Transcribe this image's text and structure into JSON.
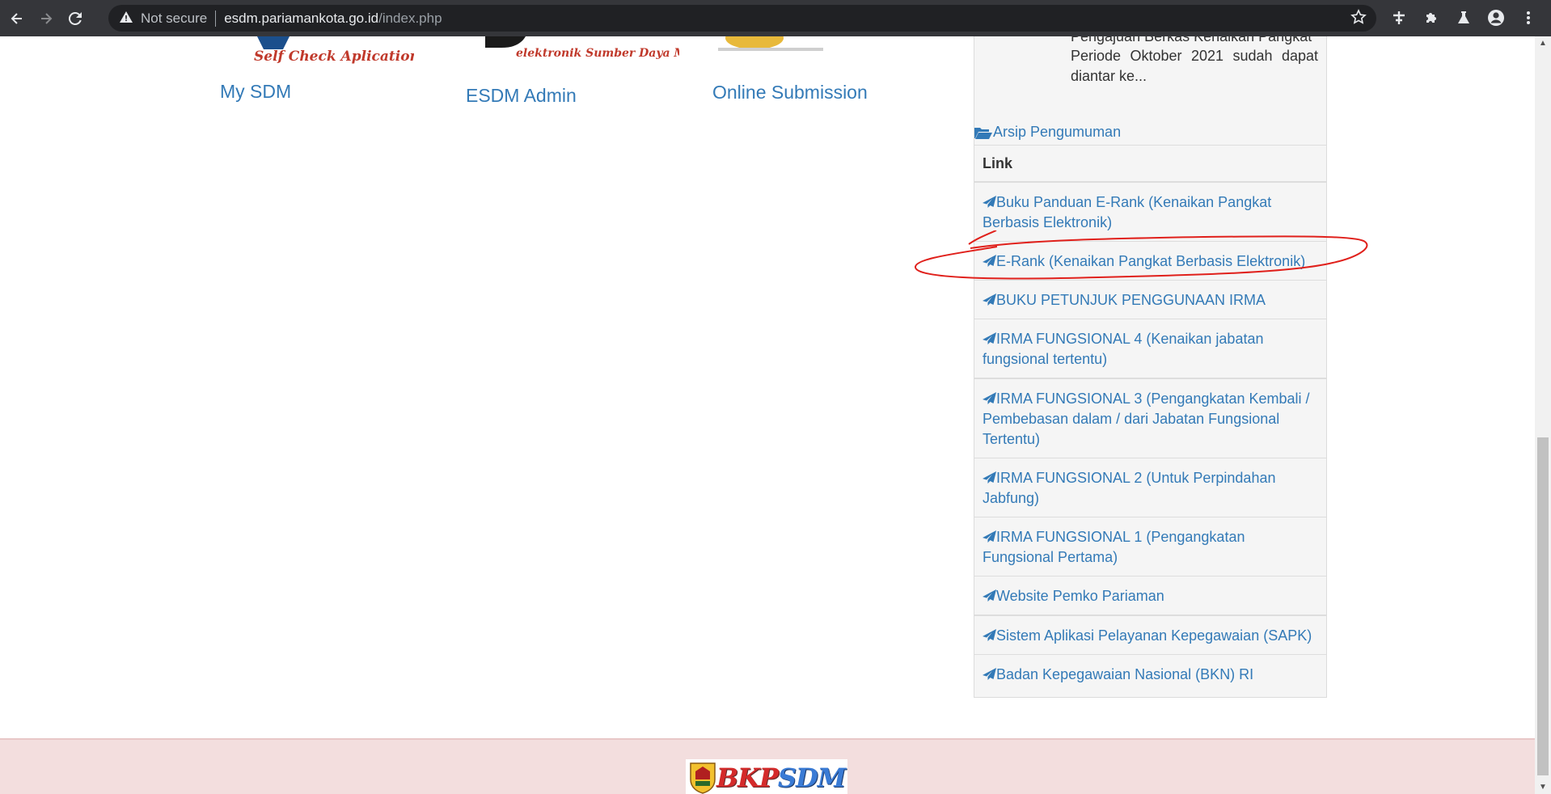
{
  "browser": {
    "security_label": "Not secure",
    "url_host": "esdm.pariamankota.go.id",
    "url_path": "/index.php"
  },
  "apps": [
    {
      "label": "My SDM",
      "logo_text": "Self Check Aplication"
    },
    {
      "label": "ESDM Admin",
      "logo_text": "elektronik Sumber Daya Manusia"
    },
    {
      "label": "Online Submission"
    }
  ],
  "announcement": {
    "cut_line": "Pengajuan Berkas Kenaikan Pangkat",
    "text": "Periode Oktober 2021 sudah dapat diantar ke...",
    "archive_label": "Arsip Pengumuman"
  },
  "links": {
    "heading": "Link",
    "items": [
      "Buku Panduan E-Rank (Kenaikan Pangkat Berbasis Elektronik)",
      "E-Rank (Kenaikan Pangkat Berbasis Elektronik)",
      "BUKU PETUNJUK PENGGUNAAN IRMA",
      "IRMA FUNGSIONAL 4 (Kenaikan jabatan fungsional tertentu)",
      "IRMA FUNGSIONAL 3 (Pengangkatan Kembali / Pembebasan dalam / dari Jabatan Fungsional Tertentu)",
      "IRMA FUNGSIONAL 2 (Untuk Perpindahan Jabfung)",
      "IRMA FUNGSIONAL 1 (Pengangkatan Fungsional Pertama)",
      "Website Pemko Pariaman",
      "Sistem Aplikasi Pelayanan Kepegawaian (SAPK)",
      "Badan Kepegawaian Nasional (BKN) RI"
    ]
  },
  "footer": {
    "logo_part1": "BKP",
    "logo_part2": "SDM"
  },
  "colors": {
    "link": "#337ab7",
    "annotation": "#e0201b",
    "footer_bg": "#f3dede"
  },
  "icons": [
    "back-icon",
    "forward-icon",
    "reload-icon",
    "warning-icon",
    "star-icon",
    "extension-pin-icon",
    "puzzle-icon",
    "labs-icon",
    "profile-icon",
    "menu-icon",
    "folder-open-icon",
    "paper-plane-icon"
  ]
}
